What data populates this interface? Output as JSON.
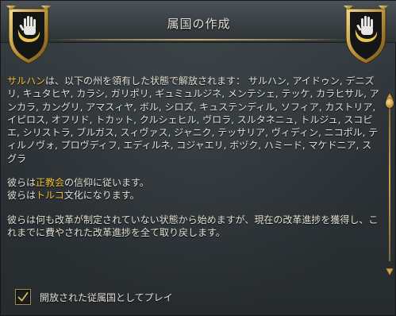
{
  "dialog": {
    "title": "属国の作成",
    "emblem_icon": "ottoman-hand-crescent-emblem"
  },
  "description": {
    "country_name": "サルハン",
    "intro_text": "は、以下の州を領有した状態で解放されます：",
    "provinces_text": "サルハン, アイドゥン, デニズリ, キュタヒヤ, カラシ, ガリポリ, ギュミュルジネ, メンテシェ, テッケ, カラヒサル, アンカラ, カングリ, アマスィヤ, ボル, シロズ, キュステンディル, ソフィア, カストリア, イピロス, オフリド, トカット, クルシェヒル, ヴロラ, スルタネニュ, トルジュ, スコピエ, シリストラ, ブルガス, スィヴァス, ジャニク, テッサリア, ヴィディン, ニコポル, ティルノヴォ, プロヴディフ, エディルネ, コジャエリ, ボヅク, ハミード, マケドニア, スグラ",
    "religion_prefix": "彼らは",
    "religion_name": "正教会",
    "religion_suffix": "の信仰に従います。",
    "culture_prefix": "彼らは",
    "culture_name": "トルコ",
    "culture_suffix": "文化になります。",
    "reform_text": "彼らは何も改革が制定されていない状態から始めますが、現在の改革進捗を獲得し、これまでに費やされた改革進捗を全て取り戻します。"
  },
  "options": {
    "play_as_released_label": "開放された従属国としてプレイ",
    "play_as_released_checked": true
  },
  "colors": {
    "highlight": "#f2c23a",
    "text": "#e6e2d7",
    "accent_gold": "#c9a550"
  }
}
